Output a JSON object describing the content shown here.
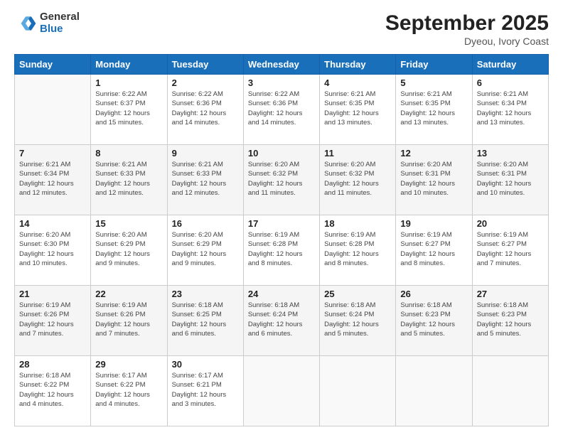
{
  "header": {
    "logo_general": "General",
    "logo_blue": "Blue",
    "month": "September 2025",
    "location": "Dyeou, Ivory Coast"
  },
  "weekdays": [
    "Sunday",
    "Monday",
    "Tuesday",
    "Wednesday",
    "Thursday",
    "Friday",
    "Saturday"
  ],
  "weeks": [
    [
      {
        "day": "",
        "info": ""
      },
      {
        "day": "1",
        "info": "Sunrise: 6:22 AM\nSunset: 6:37 PM\nDaylight: 12 hours\nand 15 minutes."
      },
      {
        "day": "2",
        "info": "Sunrise: 6:22 AM\nSunset: 6:36 PM\nDaylight: 12 hours\nand 14 minutes."
      },
      {
        "day": "3",
        "info": "Sunrise: 6:22 AM\nSunset: 6:36 PM\nDaylight: 12 hours\nand 14 minutes."
      },
      {
        "day": "4",
        "info": "Sunrise: 6:21 AM\nSunset: 6:35 PM\nDaylight: 12 hours\nand 13 minutes."
      },
      {
        "day": "5",
        "info": "Sunrise: 6:21 AM\nSunset: 6:35 PM\nDaylight: 12 hours\nand 13 minutes."
      },
      {
        "day": "6",
        "info": "Sunrise: 6:21 AM\nSunset: 6:34 PM\nDaylight: 12 hours\nand 13 minutes."
      }
    ],
    [
      {
        "day": "7",
        "info": "Sunrise: 6:21 AM\nSunset: 6:34 PM\nDaylight: 12 hours\nand 12 minutes."
      },
      {
        "day": "8",
        "info": "Sunrise: 6:21 AM\nSunset: 6:33 PM\nDaylight: 12 hours\nand 12 minutes."
      },
      {
        "day": "9",
        "info": "Sunrise: 6:21 AM\nSunset: 6:33 PM\nDaylight: 12 hours\nand 12 minutes."
      },
      {
        "day": "10",
        "info": "Sunrise: 6:20 AM\nSunset: 6:32 PM\nDaylight: 12 hours\nand 11 minutes."
      },
      {
        "day": "11",
        "info": "Sunrise: 6:20 AM\nSunset: 6:32 PM\nDaylight: 12 hours\nand 11 minutes."
      },
      {
        "day": "12",
        "info": "Sunrise: 6:20 AM\nSunset: 6:31 PM\nDaylight: 12 hours\nand 10 minutes."
      },
      {
        "day": "13",
        "info": "Sunrise: 6:20 AM\nSunset: 6:31 PM\nDaylight: 12 hours\nand 10 minutes."
      }
    ],
    [
      {
        "day": "14",
        "info": "Sunrise: 6:20 AM\nSunset: 6:30 PM\nDaylight: 12 hours\nand 10 minutes."
      },
      {
        "day": "15",
        "info": "Sunrise: 6:20 AM\nSunset: 6:29 PM\nDaylight: 12 hours\nand 9 minutes."
      },
      {
        "day": "16",
        "info": "Sunrise: 6:20 AM\nSunset: 6:29 PM\nDaylight: 12 hours\nand 9 minutes."
      },
      {
        "day": "17",
        "info": "Sunrise: 6:19 AM\nSunset: 6:28 PM\nDaylight: 12 hours\nand 8 minutes."
      },
      {
        "day": "18",
        "info": "Sunrise: 6:19 AM\nSunset: 6:28 PM\nDaylight: 12 hours\nand 8 minutes."
      },
      {
        "day": "19",
        "info": "Sunrise: 6:19 AM\nSunset: 6:27 PM\nDaylight: 12 hours\nand 8 minutes."
      },
      {
        "day": "20",
        "info": "Sunrise: 6:19 AM\nSunset: 6:27 PM\nDaylight: 12 hours\nand 7 minutes."
      }
    ],
    [
      {
        "day": "21",
        "info": "Sunrise: 6:19 AM\nSunset: 6:26 PM\nDaylight: 12 hours\nand 7 minutes."
      },
      {
        "day": "22",
        "info": "Sunrise: 6:19 AM\nSunset: 6:26 PM\nDaylight: 12 hours\nand 7 minutes."
      },
      {
        "day": "23",
        "info": "Sunrise: 6:18 AM\nSunset: 6:25 PM\nDaylight: 12 hours\nand 6 minutes."
      },
      {
        "day": "24",
        "info": "Sunrise: 6:18 AM\nSunset: 6:24 PM\nDaylight: 12 hours\nand 6 minutes."
      },
      {
        "day": "25",
        "info": "Sunrise: 6:18 AM\nSunset: 6:24 PM\nDaylight: 12 hours\nand 5 minutes."
      },
      {
        "day": "26",
        "info": "Sunrise: 6:18 AM\nSunset: 6:23 PM\nDaylight: 12 hours\nand 5 minutes."
      },
      {
        "day": "27",
        "info": "Sunrise: 6:18 AM\nSunset: 6:23 PM\nDaylight: 12 hours\nand 5 minutes."
      }
    ],
    [
      {
        "day": "28",
        "info": "Sunrise: 6:18 AM\nSunset: 6:22 PM\nDaylight: 12 hours\nand 4 minutes."
      },
      {
        "day": "29",
        "info": "Sunrise: 6:17 AM\nSunset: 6:22 PM\nDaylight: 12 hours\nand 4 minutes."
      },
      {
        "day": "30",
        "info": "Sunrise: 6:17 AM\nSunset: 6:21 PM\nDaylight: 12 hours\nand 3 minutes."
      },
      {
        "day": "",
        "info": ""
      },
      {
        "day": "",
        "info": ""
      },
      {
        "day": "",
        "info": ""
      },
      {
        "day": "",
        "info": ""
      }
    ]
  ]
}
